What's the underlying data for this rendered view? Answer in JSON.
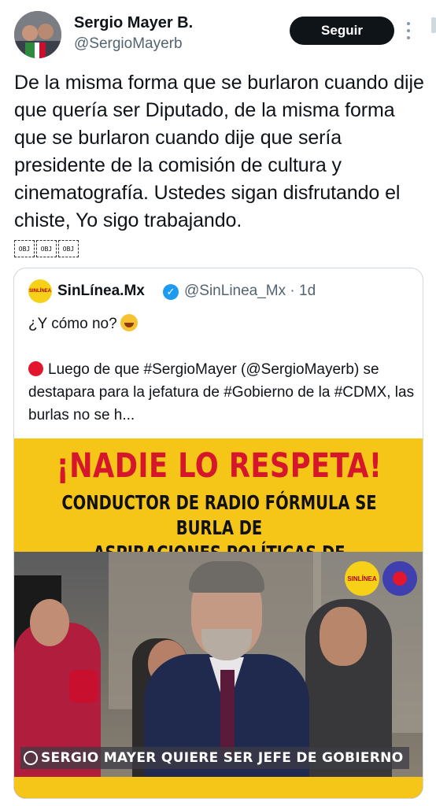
{
  "author": {
    "name": "Sergio Mayer B.",
    "handle": "@SergioMayerb",
    "follow_label": "Seguir"
  },
  "tweet": {
    "text": "De la misma forma que se burlaron cuando dije que quería ser Diputado, de la misma forma que se burlaron cuando dije que sería presidente de la comisión de cultura y cinematografía. Ustedes sigan disfrutando el chiste, Yo sigo trabajando.",
    "trailing_glyphs": [
      "OBJ",
      "OBJ",
      "OBJ"
    ]
  },
  "quote": {
    "name": "SinLínea.Mx",
    "avatar_text": "SINLÍNEA",
    "handle_time": "@SinLinea_Mx · 1d",
    "line1": "¿Y cómo no?",
    "paragraph": "Luego de que #SergioMayer (@SergioMayerb) se destapara para la jefatura de #Gobierno de la #CDMX, las burlas no se h...",
    "media": {
      "headline": "¡NADIE LO RESPETA!",
      "subheadline_1": "CONDUCTOR DE RADIO FÓRMULA SE BURLA DE",
      "subheadline_2": "ASPIRACIONES POLÍTICAS DE SERGIO MAYER",
      "logo_text": "SINLÍNEA",
      "lower_third": "SERGIO MAYER QUIERE SER JEFE DE GOBIERNO"
    }
  },
  "colors": {
    "follow_bg": "#0f1419",
    "verified": "#1d9bf0",
    "banner_yellow": "#f5c518",
    "headline_red": "#d5162b"
  }
}
